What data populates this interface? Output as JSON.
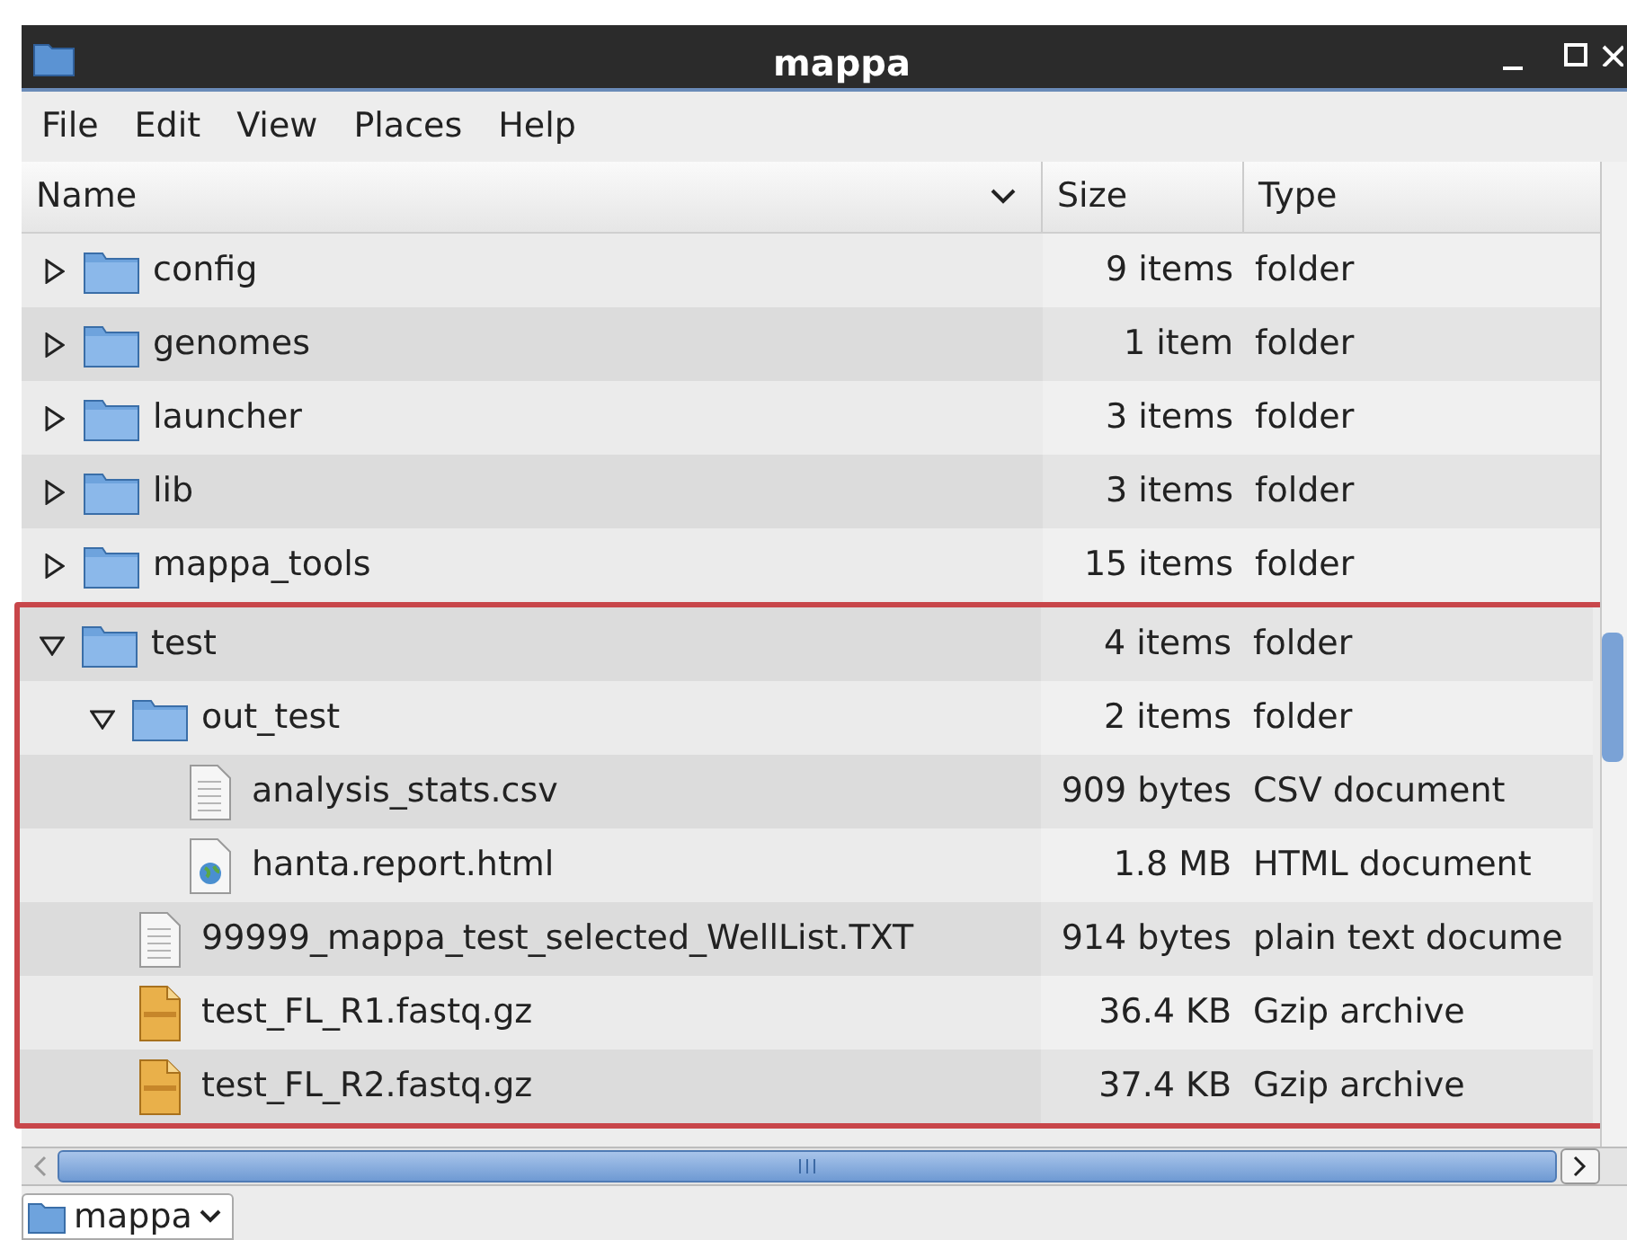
{
  "window": {
    "title": "mappa"
  },
  "menu": [
    "File",
    "Edit",
    "View",
    "Places",
    "Help"
  ],
  "columns": [
    {
      "label": "Name",
      "sorted": true
    },
    {
      "label": "Size",
      "sorted": false
    },
    {
      "label": "Type",
      "sorted": false
    }
  ],
  "tree": [
    {
      "name": "config",
      "kind": "folder",
      "size": "9 items",
      "type": "folder",
      "expanded": false
    },
    {
      "name": "genomes",
      "kind": "folder",
      "size": "1 item",
      "type": "folder",
      "expanded": false
    },
    {
      "name": "launcher",
      "kind": "folder",
      "size": "3 items",
      "type": "folder",
      "expanded": false
    },
    {
      "name": "lib",
      "kind": "folder",
      "size": "3 items",
      "type": "folder",
      "expanded": false
    },
    {
      "name": "mappa_tools",
      "kind": "folder",
      "size": "15 items",
      "type": "folder",
      "expanded": false
    },
    {
      "name": "test",
      "kind": "folder",
      "size": "4 items",
      "type": "folder",
      "expanded": true,
      "children": [
        {
          "name": "out_test",
          "kind": "folder",
          "size": "2 items",
          "type": "folder",
          "expanded": true,
          "children": [
            {
              "name": "analysis_stats.csv",
              "kind": "text",
              "size": "909 bytes",
              "type": "CSV document"
            },
            {
              "name": "hanta.report.html",
              "kind": "html",
              "size": "1.8 MB",
              "type": "HTML document"
            }
          ]
        },
        {
          "name": "99999_mappa_test_selected_WellList.TXT",
          "kind": "text",
          "size": "914 bytes",
          "type": "plain text docume"
        },
        {
          "name": "test_FL_R1.fastq.gz",
          "kind": "archive",
          "size": "36.4 KB",
          "type": "Gzip archive"
        },
        {
          "name": "test_FL_R2.fastq.gz",
          "kind": "archive",
          "size": "37.4 KB",
          "type": "Gzip archive"
        }
      ]
    }
  ],
  "path_bar": [
    {
      "label": "mappa"
    }
  ]
}
